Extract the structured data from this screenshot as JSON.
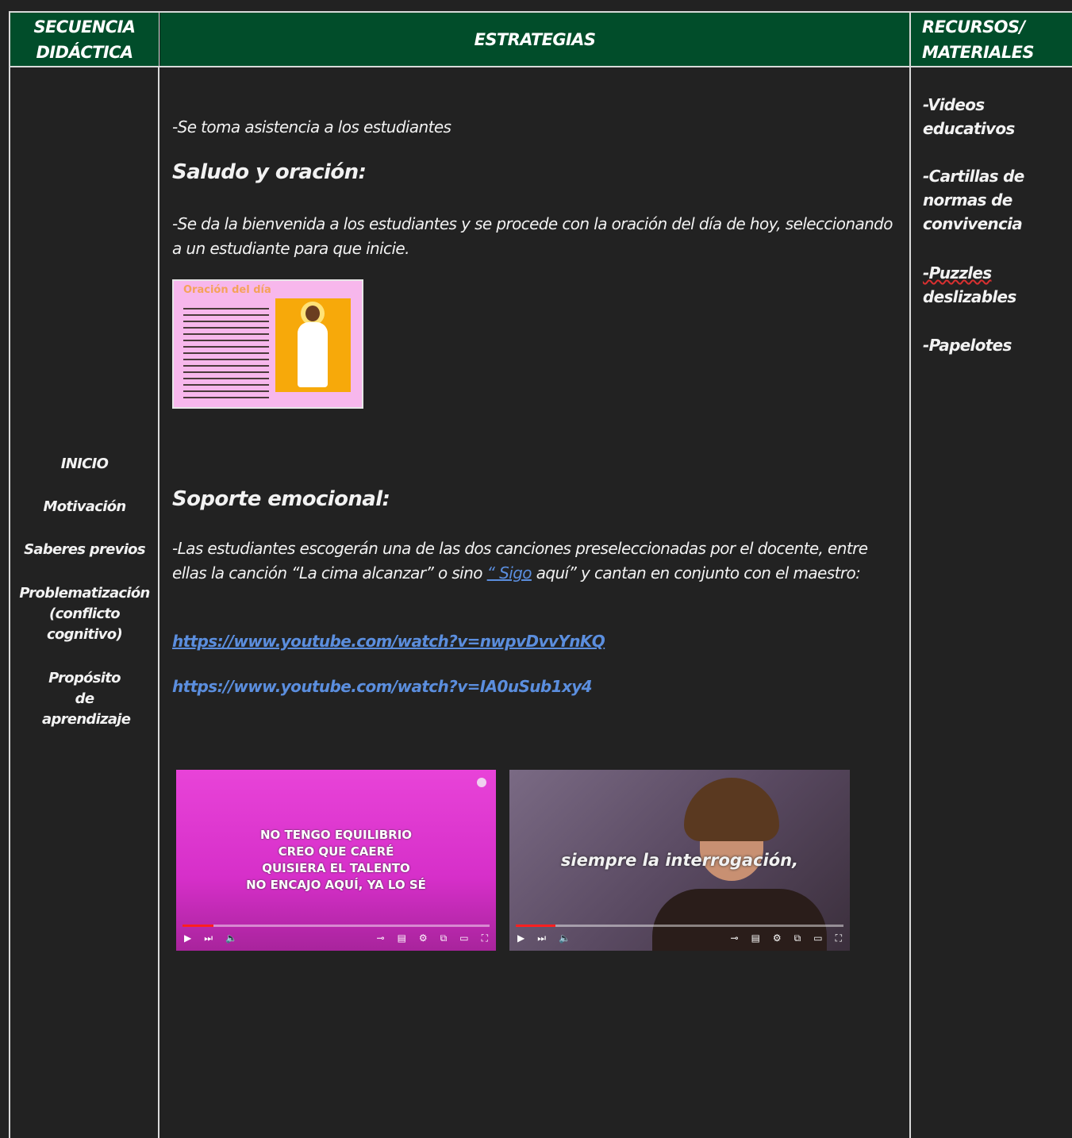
{
  "header": {
    "col1": "SECUENCIA DIDÁCTICA",
    "col2": "ESTRATEGIAS",
    "col3": "RECURSOS/ MATERIALES"
  },
  "sequence": {
    "inicio": "INICIO",
    "motivacion": "Motivación",
    "saberes": "Saberes previos",
    "problematizacion": "Problematización (conflicto cognitivo)",
    "proposito": "Propósito de aprendizaje"
  },
  "strategies": {
    "asistencia": "-Se toma asistencia a los estudiantes",
    "saludo_title": "Saludo y oración:",
    "saludo_text": "-Se da la bienvenida a los estudiantes y se procede con la oración del día de hoy, seleccionando a un estudiante para que inicie.",
    "prayer_image_title": "Oración del día",
    "soporte_title": "Soporte emocional:",
    "soporte_text_1": "-Las estudiantes escogerán una de las dos canciones preseleccionadas por el docente, entre ellas la canción “La cima alcanzar” o sino ",
    "soporte_text_link": "“ Sigo",
    "soporte_text_2": " aquí” y cantan en conjunto con el maestro:",
    "link1": "https://www.youtube.com/watch?v=nwpvDvvYnKQ",
    "link2": "https://www.youtube.com/watch?v=IA0uSub1xy4"
  },
  "videos": {
    "video1_caption": [
      "NO TENGO EQUILIBRIO",
      "CREO QUE CAERÉ",
      "QUISIERA EL TALENTO",
      "NO ENCAJO AQUÍ, YA LO SÉ"
    ],
    "video1_progress": 0.1,
    "video2_caption": "siempre la interrogación,",
    "video2_progress": 0.12
  },
  "resources": {
    "videos_label": "-Videos educativos",
    "cartillas_label": "-Cartillas de normas de convivencia",
    "puzzles_word": "-Puzzles",
    "puzzles_rest": " deslizables",
    "papelotes_label": "-Papelotes"
  },
  "colors": {
    "header_bg": "#014d2a",
    "page_bg": "#222222",
    "link": "#5b8ede"
  }
}
